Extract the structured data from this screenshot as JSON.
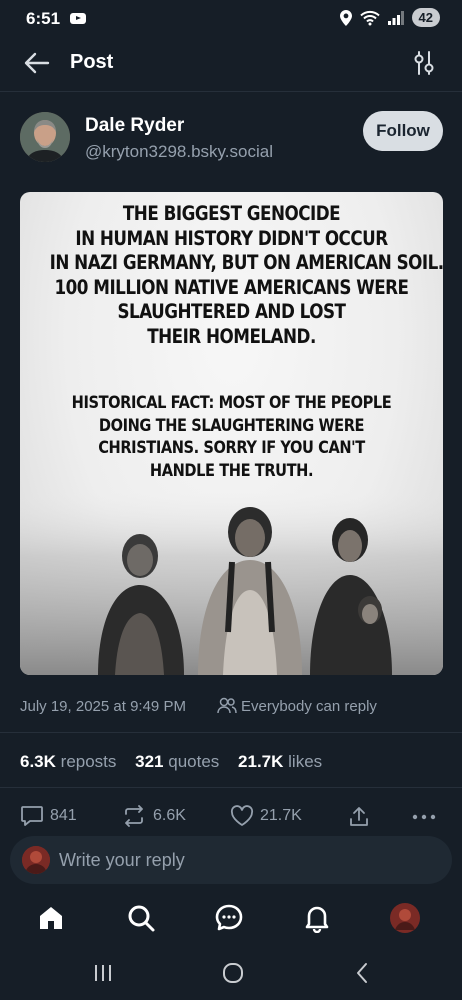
{
  "status_bar": {
    "time": "6:51",
    "battery": "42",
    "network": "5"
  },
  "header": {
    "title": "Post",
    "back_icon": "back-arrow-icon",
    "filter_icon": "sliders-icon"
  },
  "author": {
    "name": "Dale Ryder",
    "handle": "@kryton3298.bsky.social",
    "follow_label": "Follow"
  },
  "post_image": {
    "headline_lines": [
      "THE BIGGEST GENOCIDE",
      "IN HUMAN HISTORY DIDN'T OCCUR",
      "IN NAZI GERMANY, BUT ON AMERICAN SOIL.",
      "100 MILLION NATIVE AMERICANS WERE",
      "SLAUGHTERED AND LOST",
      "THEIR HOMELAND."
    ],
    "sub_lines": [
      "HISTORICAL FACT: MOST OF THE PEOPLE",
      "DOING THE SLAUGHTERING WERE",
      "CHRISTIANS. SORRY IF YOU CAN'T",
      "HANDLE THE TRUTH."
    ]
  },
  "meta": {
    "date": "July 19, 2025 at 9:49 PM",
    "reply_setting": "Everybody can reply"
  },
  "stats": {
    "reposts_count": "6.3K",
    "reposts_label": "reposts",
    "quotes_count": "321",
    "quotes_label": "quotes",
    "likes_count": "21.7K",
    "likes_label": "likes"
  },
  "actions": {
    "replies": "841",
    "reposts": "6.6K",
    "likes": "21.7K"
  },
  "reply_box": {
    "placeholder": "Write your reply"
  },
  "colors": {
    "background": "#161e27",
    "muted": "#95a0ad",
    "reply_box": "#1f2933"
  }
}
